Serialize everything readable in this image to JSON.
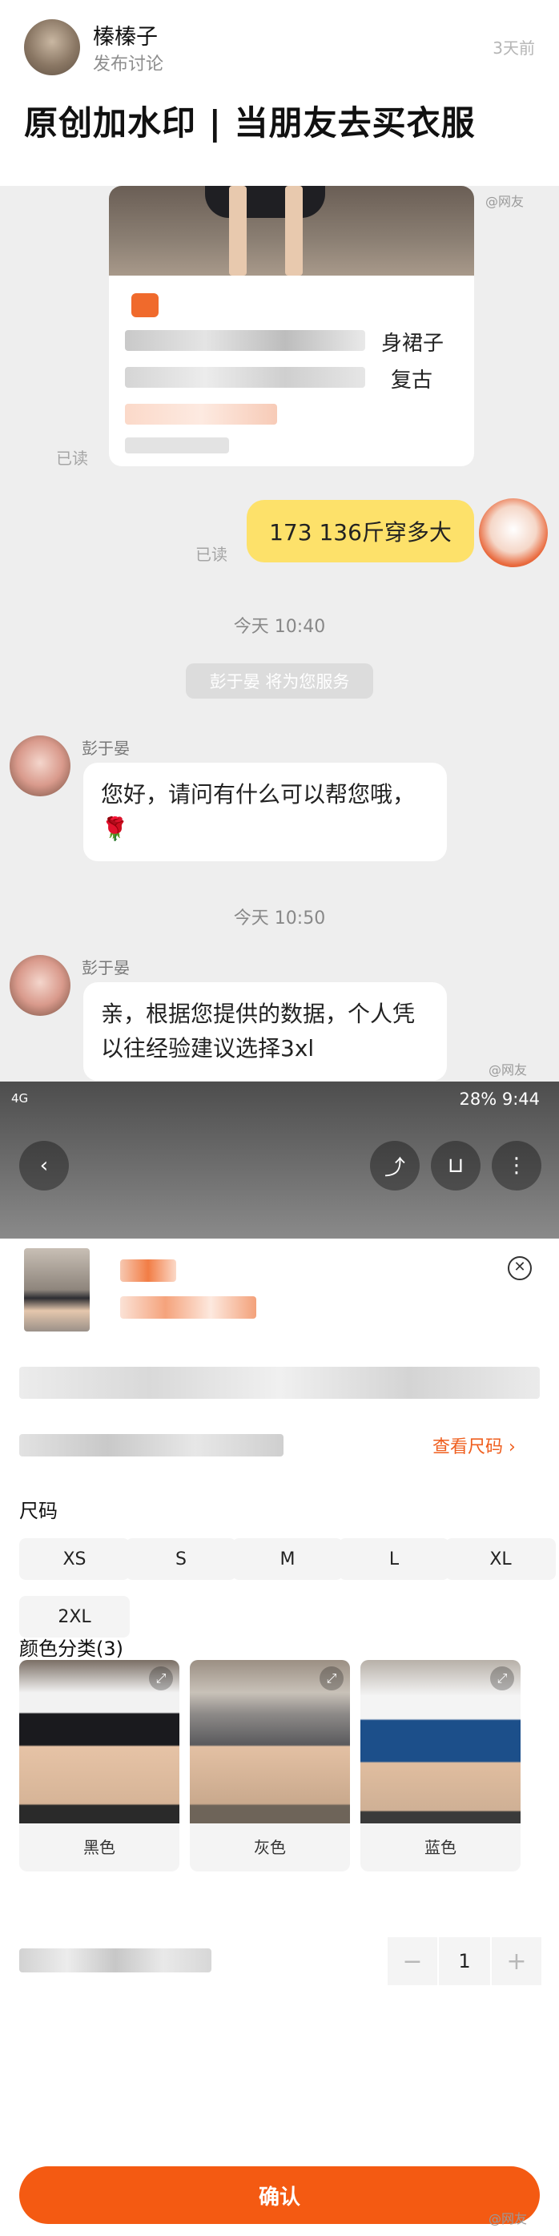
{
  "post": {
    "author": "榛榛子",
    "subtitle": "发布讨论",
    "time": "3天前",
    "title": "原创加水印 | 当朋友去买衣服"
  },
  "chat": {
    "watermark": "@网友",
    "card_text_1": "身裙子",
    "card_text_2": "复古",
    "read_left": "已读",
    "user_message": "173 136斤穿多大",
    "read_right": "已读",
    "time_1": "今天 10:40",
    "system_notice": "彭于晏 将为您服务",
    "agent_name": "彭于晏",
    "agent_message_1": "您好，请问有什么可以帮您哦，",
    "rose": "🌹",
    "time_2": "今天 10:50",
    "agent_message_2": "亲，根据您提供的数据，个人凭以往经验建议选择3xl"
  },
  "product": {
    "status_left": "4G",
    "status_right": "28%  9:44",
    "size_chart_link": "查看尺码 ›",
    "size_label": "尺码",
    "sizes": [
      "XS",
      "S",
      "M",
      "L",
      "XL",
      "2XL"
    ],
    "color_label": "颜色分类(3)",
    "colors": [
      "黑色",
      "灰色",
      "蓝色"
    ],
    "quantity": "1",
    "minus": "−",
    "plus": "+",
    "confirm": "确认",
    "close": "✕"
  }
}
